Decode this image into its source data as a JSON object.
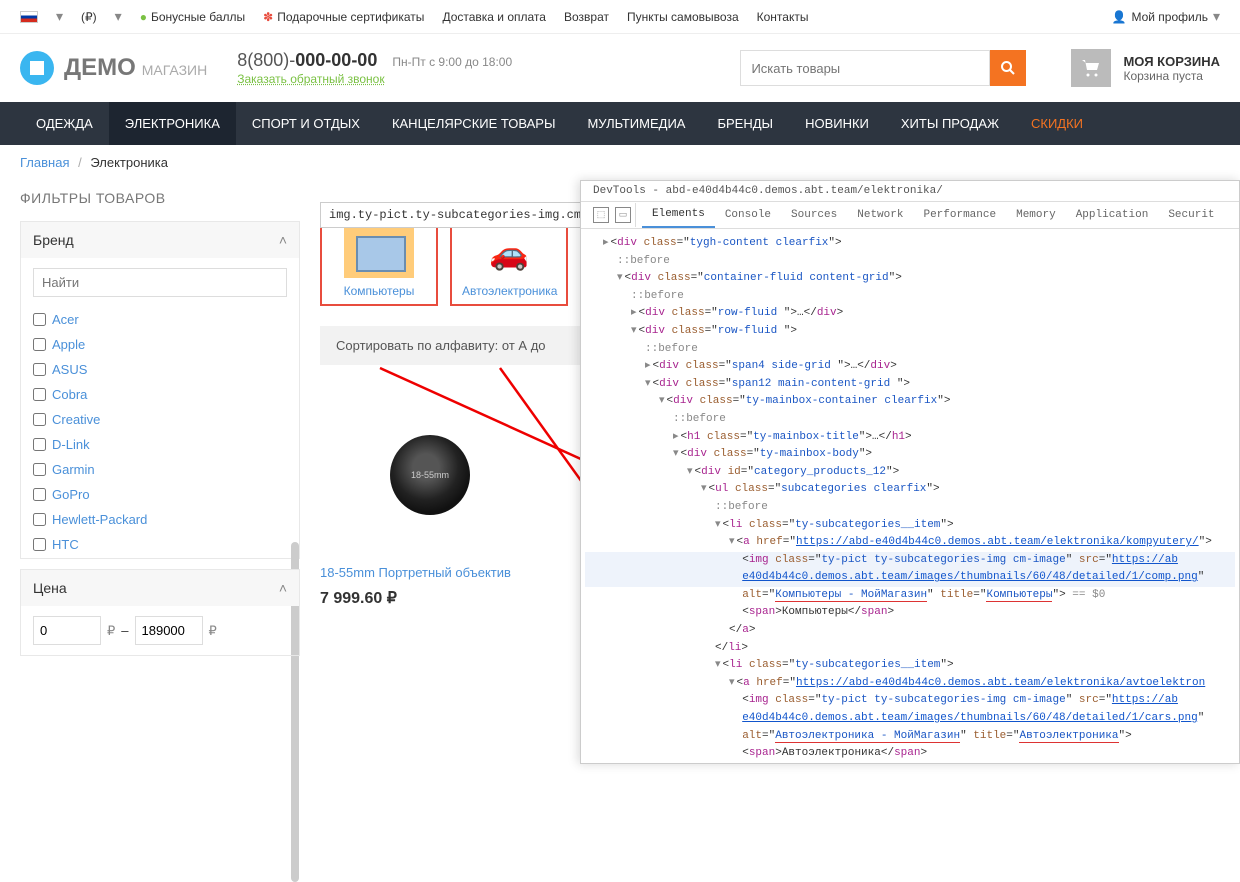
{
  "top": {
    "currency": "(₽)",
    "bonus": "Бонусные баллы",
    "gift": "Подарочные сертификаты",
    "delivery": "Доставка и оплата",
    "return": "Возврат",
    "pickup": "Пункты самовывоза",
    "contacts": "Контакты",
    "profile": "Мой профиль"
  },
  "header": {
    "demo": "ДЕМО",
    "shop": "МАГАЗИН",
    "phone_prefix": "8(800)-",
    "phone_num": "000-00-00",
    "hours": "Пн-Пт с 9:00 до 18:00",
    "callback": "Заказать обратный звонок",
    "search_placeholder": "Искать товары",
    "cart_title": "МОЯ КОРЗИНА",
    "cart_empty": "Корзина пуста"
  },
  "nav": [
    "ОДЕЖДА",
    "ЭЛЕКТРОНИКА",
    "СПОРТ И ОТДЫХ",
    "КАНЦЕЛЯРСКИЕ ТОВАРЫ",
    "МУЛЬТИМЕДИА",
    "БРЕНДЫ",
    "НОВИНКИ",
    "ХИТЫ ПРОДАЖ",
    "СКИДКИ"
  ],
  "breadcrumb": {
    "home": "Главная",
    "current": "Электроника"
  },
  "sidebar": {
    "title": "ФИЛЬТРЫ ТОВАРОВ",
    "brand_label": "Бренд",
    "brand_search": "Найти",
    "brands": [
      "Acer",
      "Apple",
      "ASUS",
      "Cobra",
      "Creative",
      "D-Link",
      "Garmin",
      "GoPro",
      "Hewlett-Packard",
      "HTC"
    ],
    "price_label": "Цена",
    "price_min": "0",
    "price_max": "189000"
  },
  "main": {
    "tooltip": "img.ty-pict.ty-subcategories-img.cm",
    "subcat1": "Компьютеры",
    "subcat2": "Автоэлектроника",
    "sort": "Сортировать по алфавиту: от А до",
    "product_title": "18-55mm Портретный объектив",
    "product_price": "7 999.60 ₽",
    "lens_text": "18-55mm"
  },
  "devtools": {
    "title": "DevTools - abd-e40d4b44c0.demos.abt.team/elektronika/",
    "tabs": [
      "Elements",
      "Console",
      "Sources",
      "Network",
      "Performance",
      "Memory",
      "Application",
      "Securit"
    ],
    "url1": "https://abd-e40d4b44c0.demos.abt.team/elektronika/kompyutery/",
    "img_url_prefix": "https://ab",
    "img_path1": "e40d4b44c0.demos.abt.team/images/thumbnails/60/48/detailed/1/comp.png",
    "alt1": "Компьютеры - МойМагазин",
    "title1": "Компьютеры",
    "span1": "Компьютеры",
    "url2": "https://abd-e40d4b44c0.demos.abt.team/elektronika/avtoelektron",
    "img_path2": "e40d4b44c0.demos.abt.team/images/thumbnails/60/48/detailed/1/cars.png",
    "alt2": "Автоэлектроника - МойМагазин",
    "title2": "Автоэлектроника",
    "span2": "Автоэлектроника"
  }
}
